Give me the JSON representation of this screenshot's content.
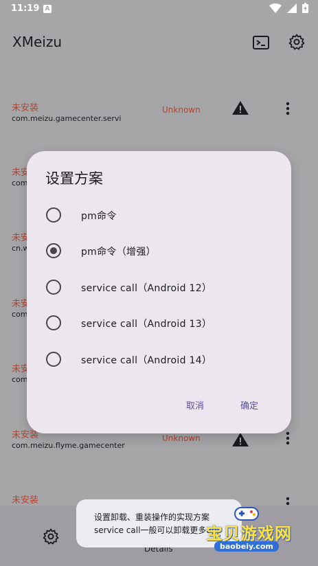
{
  "status_bar": {
    "time": "11:19",
    "app_icon_letter": "A"
  },
  "app_bar": {
    "title": "XMeizu"
  },
  "list": {
    "rows": [
      {
        "state": "未安装",
        "package": "com.meizu.gamecenter.servi",
        "status": "Unknown"
      },
      {
        "state": "未安装",
        "package": "com.",
        "status": ""
      },
      {
        "state": "未安装",
        "package": "cn.w",
        "status": ""
      },
      {
        "state": "未安",
        "package": "com",
        "status": ""
      },
      {
        "state": "未安",
        "package": "com",
        "status": ""
      },
      {
        "state": "未安装",
        "package": "com.meizu.flyme.gamecenter",
        "status": "Unknown"
      },
      {
        "state": "未安装",
        "package": "",
        "status": ""
      }
    ]
  },
  "dialog": {
    "title": "设置方案",
    "options": [
      {
        "label": "pm命令",
        "selected": false
      },
      {
        "label": "pm命令（增强）",
        "selected": true
      },
      {
        "label": "service call（Android 12）",
        "selected": false
      },
      {
        "label": "service call（Android 13）",
        "selected": false
      },
      {
        "label": "service call（Android 14）",
        "selected": false
      }
    ],
    "cancel_label": "取消",
    "confirm_label": "确定"
  },
  "bottom_nav": {
    "details_label": "Details"
  },
  "toast": {
    "line1": "设置卸载、重装操作的实现方案",
    "line2": "service call一般可以卸载更多app"
  },
  "watermark": {
    "text": "宝贝游戏网",
    "url": "baobeiy.com"
  },
  "colors": {
    "accent": "#5b4fa0",
    "error": "#b5432e",
    "dialog_bg": "#ece6ee",
    "scrim_bg": "#a6a6a9"
  }
}
